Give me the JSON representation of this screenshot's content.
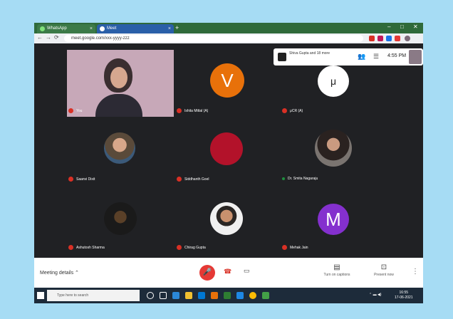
{
  "browser": {
    "tabs": [
      {
        "label": "WhatsApp"
      },
      {
        "label": "Meet"
      }
    ],
    "new_tab": "+",
    "controls": {
      "minimize": "–",
      "maximize": "□",
      "close": "✕"
    },
    "nav": {
      "back": "←",
      "forward": "→",
      "reload": "⟳"
    },
    "url": "meet.google.com/xxx-yyyy-zzz"
  },
  "presentation_bar": {
    "text": "Shiva Gupta and 18 more",
    "time": "4:55 PM"
  },
  "participants": [
    {
      "name": "You",
      "type": "video"
    },
    {
      "name": "Ishita Mittal (A)",
      "type": "letter",
      "letter": "V",
      "color": "#e8710a"
    },
    {
      "name": "μCR (A)",
      "type": "logo"
    },
    {
      "name": "Saanvi Dixit",
      "type": "photo"
    },
    {
      "name": "Siddhanth Goel",
      "type": "photo"
    },
    {
      "name": "Dr. Smita Nagaraju",
      "type": "photo",
      "mic_on": true
    },
    {
      "name": "Ashutosh Sharma",
      "type": "photo"
    },
    {
      "name": "Chirag Gupta",
      "type": "photo"
    },
    {
      "name": "Mehak Jain",
      "type": "letter",
      "letter": "M",
      "color": "#8430ce"
    }
  ],
  "bottom_bar": {
    "meeting_details": "Meeting details",
    "chevron": "⌃",
    "mic_icon": "🎤",
    "hangup_icon": "☎",
    "camera_icon": "▭",
    "captions_label": "Turn on captions",
    "present_label": "Present now",
    "more_icon": "⋮"
  },
  "taskbar": {
    "search_placeholder": "Type here to search",
    "clock_time": "16:55",
    "clock_date": "17-06-2021"
  }
}
